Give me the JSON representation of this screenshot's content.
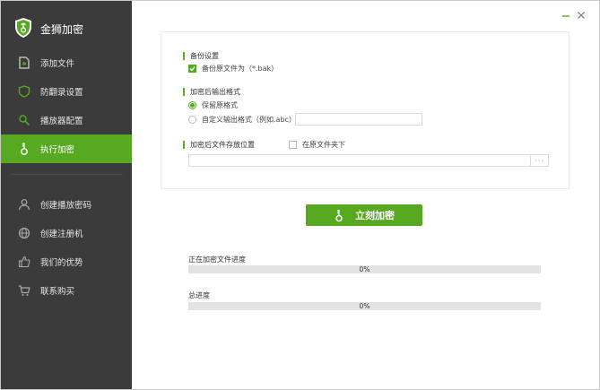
{
  "app": {
    "title": "金狮加密"
  },
  "sidebar": {
    "items": [
      {
        "label": "添加文件",
        "icon": "add-file-icon"
      },
      {
        "label": "防翻录设置",
        "icon": "shield-icon"
      },
      {
        "label": "播放器配置",
        "icon": "search-key-icon"
      },
      {
        "label": "执行加密",
        "icon": "lock-key-icon",
        "active": true
      },
      {
        "label": "创建播放密码",
        "icon": "user-icon"
      },
      {
        "label": "创建注册机",
        "icon": "globe-icon"
      },
      {
        "label": "我们的优势",
        "icon": "thumbs-up-icon"
      },
      {
        "label": "联系购买",
        "icon": "cart-icon"
      }
    ]
  },
  "window_controls": {
    "minimize": "minimize-icon",
    "close": "close-icon"
  },
  "backup": {
    "title": "备份设置",
    "checkbox_label": "备份原文件为（*.bak）",
    "checked": true
  },
  "output_format": {
    "title": "加密后输出格式",
    "option_keep": "保留原格式",
    "option_custom": "自定义输出格式（例如.abc）",
    "selected": "keep",
    "custom_value": ""
  },
  "location": {
    "title": "加密后文件存放位置",
    "same_folder_label": "在原文件夹下",
    "same_folder_checked": false,
    "path_value": "",
    "browse_label": "···"
  },
  "action": {
    "encrypt_label": "立刻加密"
  },
  "progress": {
    "current_label": "正在加密文件进度",
    "current_value": 0,
    "current_text": "0%",
    "total_label": "总进度",
    "total_value": 0,
    "total_text": "0%"
  },
  "colors": {
    "accent": "#56a920",
    "sidebar_bg": "#3b3b3b"
  }
}
